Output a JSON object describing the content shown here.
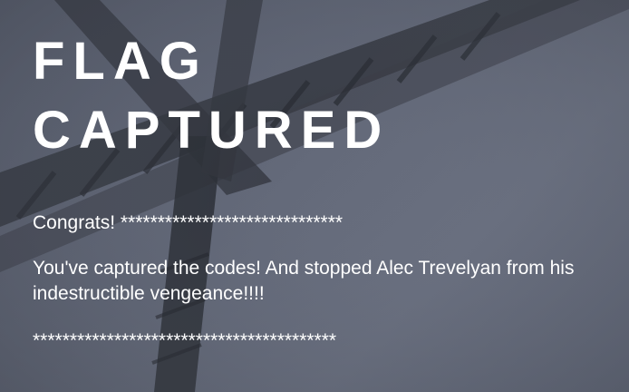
{
  "page": {
    "title_line1": "FLAG",
    "title_line2": "CAPTURED",
    "congrats": "Congrats! ******************************",
    "message": "You've captured the codes! And stopped Alec Trevelyan from his indestructible vengeance!!!!",
    "footer": "*****************************************"
  },
  "colors": {
    "text": "#ffffff",
    "background": "#626878",
    "structure": "#2a2d34"
  }
}
